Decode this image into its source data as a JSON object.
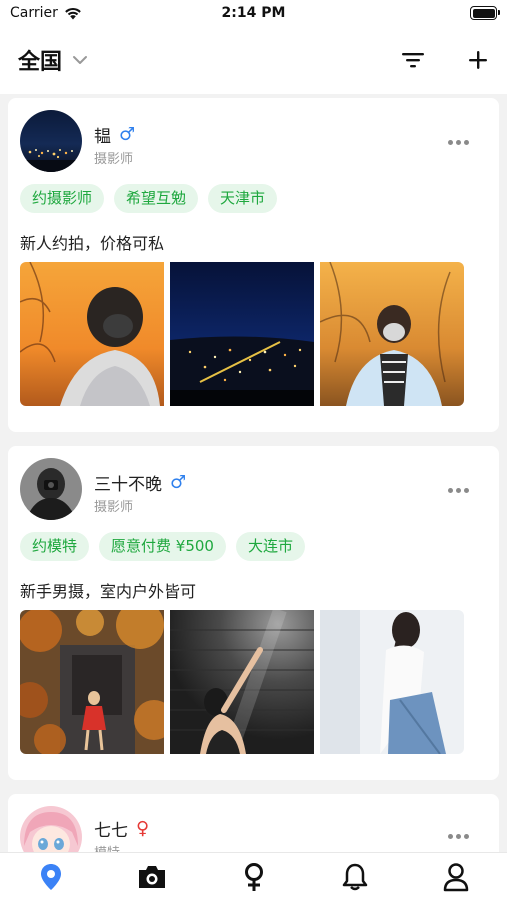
{
  "status_bar": {
    "carrier": "Carrier",
    "time": "2:14 PM"
  },
  "nav": {
    "region": "全国"
  },
  "posts": [
    {
      "name": "韫",
      "gender": "male",
      "gender_symbol": "♂",
      "role": "摄影师",
      "tags": [
        "约摄影师",
        "希望互勉",
        "天津市"
      ],
      "text": "新人约拍，价格可私"
    },
    {
      "name": "三十不晚",
      "gender": "male",
      "gender_symbol": "♂",
      "role": "摄影师",
      "tags": [
        "约模特",
        "愿意付费 ¥500",
        "大连市"
      ],
      "text": "新手男摄，室内户外皆可"
    },
    {
      "name": "七七",
      "gender": "female",
      "gender_symbol": "♀",
      "role": "模特"
    }
  ],
  "tabs": [
    {
      "icon": "location-pin-icon",
      "active": true
    },
    {
      "icon": "camera-icon",
      "active": false
    },
    {
      "icon": "female-symbol-icon",
      "active": false
    },
    {
      "icon": "bell-icon",
      "active": false
    },
    {
      "icon": "person-icon",
      "active": false
    }
  ],
  "colors": {
    "accent": "#3b82f6",
    "tag_bg": "#e6f6ea",
    "tag_text": "#1fa83f",
    "male": "#2f80ed",
    "female": "#e53935"
  }
}
